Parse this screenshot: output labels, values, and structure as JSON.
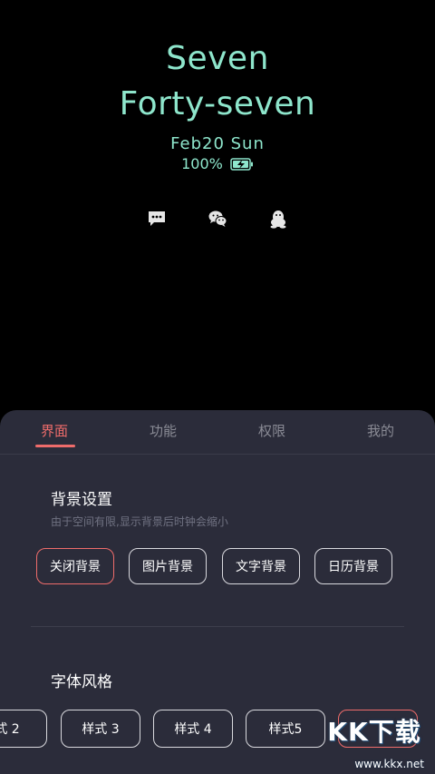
{
  "clock": {
    "hour": "Seven",
    "minute": "Forty-seven",
    "date": "Feb20 Sun",
    "battery": "100%",
    "color": "#8ee6cc"
  },
  "notifications": {
    "icons": [
      "message-icon",
      "wechat-icon",
      "qq-icon"
    ]
  },
  "tabs": [
    {
      "label": "界面",
      "active": true
    },
    {
      "label": "功能",
      "active": false
    },
    {
      "label": "权限",
      "active": false
    },
    {
      "label": "我的",
      "active": false
    }
  ],
  "background_settings": {
    "title": "背景设置",
    "subtitle": "由于空间有限,显示背景后时钟会缩小",
    "options": [
      {
        "label": "关闭背景",
        "selected": true
      },
      {
        "label": "图片背景",
        "selected": false
      },
      {
        "label": "文字背景",
        "selected": false
      },
      {
        "label": "日历背景",
        "selected": false
      }
    ]
  },
  "font_style": {
    "title": "字体风格",
    "options": [
      {
        "label": "式 2"
      },
      {
        "label": "样式 3"
      },
      {
        "label": "样式 4"
      },
      {
        "label": "样式5"
      },
      {
        "label": ""
      }
    ]
  },
  "watermark": {
    "title": "KK下载",
    "subtitle": "www.kkx.net"
  },
  "colors": {
    "accent": "#ef6c6b",
    "panel": "#2b2c3a",
    "text_muted": "#8a8b95"
  }
}
